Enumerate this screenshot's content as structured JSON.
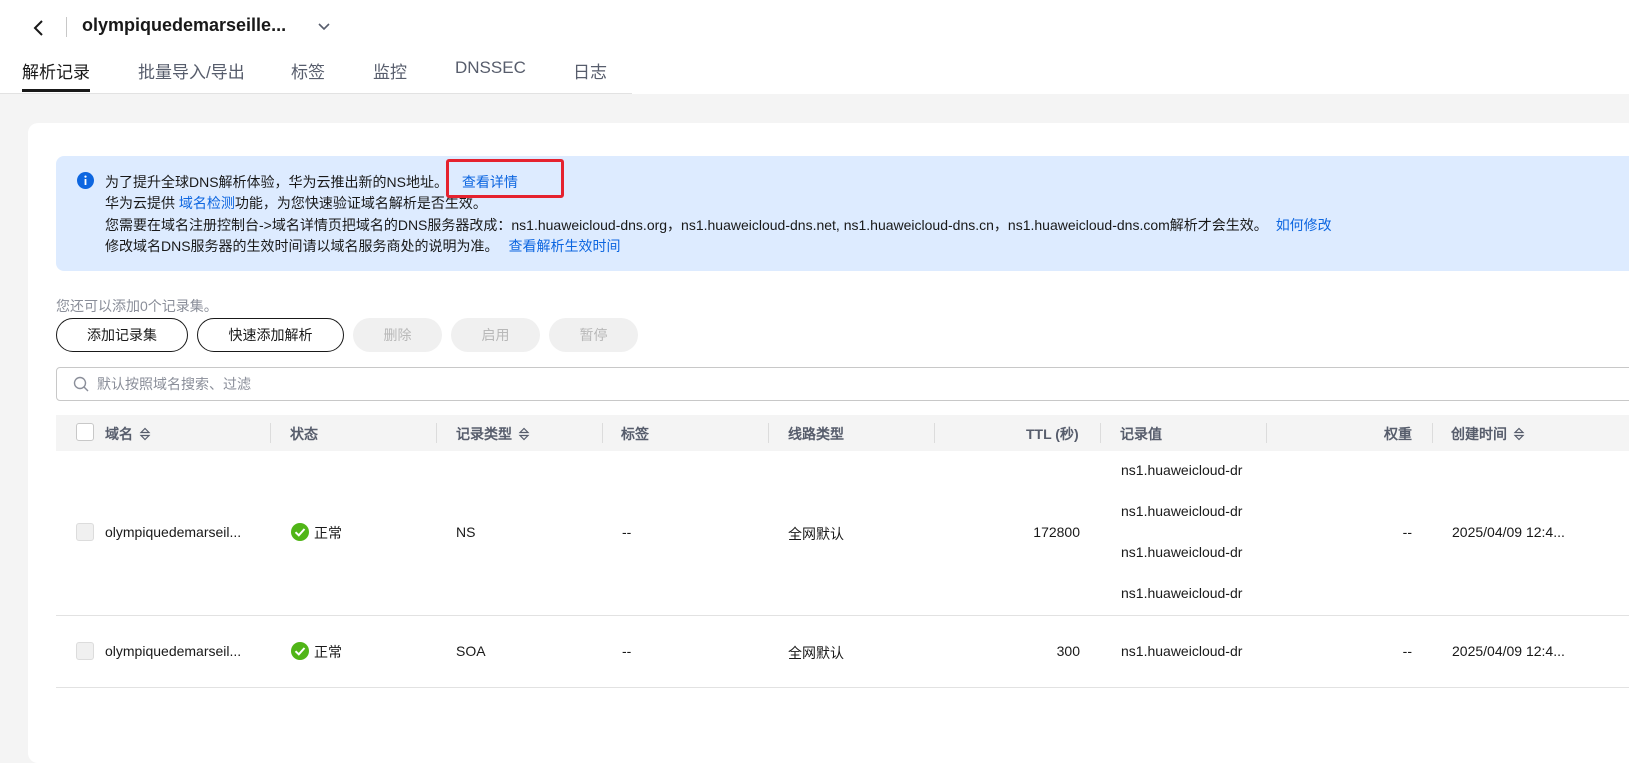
{
  "header": {
    "title": "olympiquedemarseille...",
    "tabs": [
      {
        "label": "解析记录",
        "active": true
      },
      {
        "label": "批量导入/导出"
      },
      {
        "label": "标签"
      },
      {
        "label": "监控"
      },
      {
        "label": "DNSSEC"
      },
      {
        "label": "日志"
      }
    ]
  },
  "notice": {
    "line1": "为了提升全球DNS解析体验，华为云推出新的NS地址。",
    "line1_link": "查看详情",
    "line2_pre": "华为云提供 ",
    "line2_link": "域名检测",
    "line2_post": "功能，为您快速验证域名解析是否生效。",
    "line3": "您需要在域名注册控制台->域名详情页把域名的DNS服务器改成：ns1.huaweicloud-dns.org，ns1.huaweicloud-dns.net, ns1.huaweicloud-dns.cn，ns1.huaweicloud-dns.com解析才会生效。",
    "line3_link": "如何修改",
    "line4": "修改域名DNS服务器的生效时间请以域名服务商处的说明为准。",
    "line4_link": "查看解析生效时间"
  },
  "quota_text": "您还可以添加0个记录集。",
  "toolbar": {
    "add_record_set": "添加记录集",
    "quick_add": "快速添加解析",
    "delete": "删除",
    "enable": "启用",
    "pause": "暂停"
  },
  "search": {
    "placeholder": "默认按照域名搜索、过滤"
  },
  "table": {
    "columns": {
      "domain": "域名",
      "status": "状态",
      "record_type": "记录类型",
      "tag": "标签",
      "line_type": "线路类型",
      "ttl": "TTL (秒)",
      "value": "记录值",
      "weight": "权重",
      "created": "创建时间"
    },
    "rows": [
      {
        "domain": "olympiquedemarseil...",
        "status": "正常",
        "record_type": "NS",
        "tag": "--",
        "line_type": "全网默认",
        "ttl": "172800",
        "values": [
          "ns1.huaweicloud-dr",
          "ns1.huaweicloud-dr",
          "ns1.huaweicloud-dr",
          "ns1.huaweicloud-dr"
        ],
        "weight": "--",
        "created": "2025/04/09 12:4..."
      },
      {
        "domain": "olympiquedemarseil...",
        "status": "正常",
        "record_type": "SOA",
        "tag": "--",
        "line_type": "全网默认",
        "ttl": "300",
        "values": [
          "ns1.huaweicloud-dr"
        ],
        "weight": "--",
        "created": "2025/04/09 12:4..."
      }
    ]
  },
  "colors": {
    "link": "#0d66e0",
    "notice_bg": "#ddebff",
    "status_ok": "#50b517",
    "highlight": "#e5222f"
  }
}
